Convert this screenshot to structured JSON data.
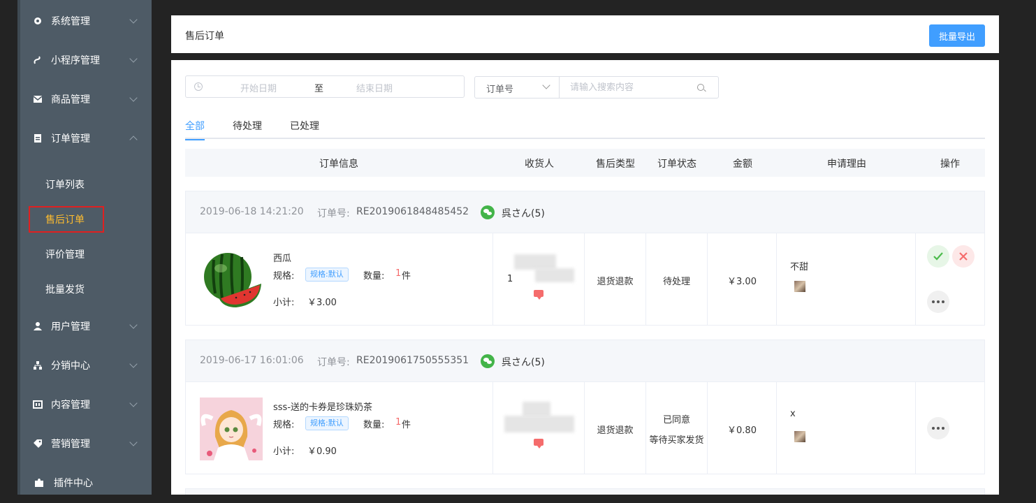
{
  "sidebar": {
    "menu": [
      {
        "label": "系统管理",
        "icon": "gear-icon"
      },
      {
        "label": "小程序管理",
        "icon": "link-icon"
      },
      {
        "label": "商品管理",
        "icon": "mail-icon"
      },
      {
        "label": "订单管理",
        "icon": "clipboard-icon"
      },
      {
        "label": "用户管理",
        "icon": "user-icon"
      },
      {
        "label": "分销中心",
        "icon": "hierarchy-icon"
      },
      {
        "label": "内容管理",
        "icon": "content-icon"
      },
      {
        "label": "营销管理",
        "icon": "tag-icon"
      },
      {
        "label": "插件中心",
        "icon": "puzzle-icon"
      }
    ],
    "sub": [
      {
        "label": "订单列表"
      },
      {
        "label": "售后订单"
      },
      {
        "label": "评价管理"
      },
      {
        "label": "批量发货"
      }
    ],
    "active_sub_color": "#ffbd2e"
  },
  "header": {
    "title": "售后订单",
    "export_label": "批量导出"
  },
  "filters": {
    "start_placeholder": "开始日期",
    "range_sep": "至",
    "end_placeholder": "结束日期",
    "search_type": "订单号",
    "search_placeholder": "请输入搜索内容"
  },
  "tabs": [
    "全部",
    "待处理",
    "已处理"
  ],
  "columns": [
    "订单信息",
    "收货人",
    "售后类型",
    "订单状态",
    "金额",
    "申请理由",
    "操作"
  ],
  "orders": [
    {
      "time": "2019-06-18 14:21:20",
      "order_no_label": "订单号:",
      "order_no": "RE2019061848485452",
      "user": "呉さん(5)",
      "goods_name": "西瓜",
      "spec_label": "规格:",
      "spec": "规格:默认",
      "qty_label": "数量:",
      "qty": "1",
      "qty_unit": "件",
      "subtotal_label": "小计:",
      "subtotal": "￥3.00",
      "receiver_digit": "1",
      "type": "退货退款",
      "status": "待处理",
      "amount": "￥3.00",
      "reason": "不甜"
    },
    {
      "time": "2019-06-17 16:01:06",
      "order_no_label": "订单号:",
      "order_no": "RE2019061750555351",
      "user": "呉さん(5)",
      "goods_name": "sss-送的卡券是珍珠奶茶",
      "spec_label": "规格:",
      "spec": "规格:默认",
      "qty_label": "数量:",
      "qty": "1",
      "qty_unit": "件",
      "subtotal_label": "小计:",
      "subtotal": "￥0.90",
      "type": "退货退款",
      "status_line1": "已同意",
      "status_line2": "等待买家发货",
      "amount": "￥0.80",
      "reason": "x"
    }
  ],
  "colors": {
    "sidebar_bg": "#4e5b66",
    "primary": "#409eff",
    "danger": "#f56c6c",
    "success": "#4cbb4c",
    "highlight_box": "#e02020"
  }
}
